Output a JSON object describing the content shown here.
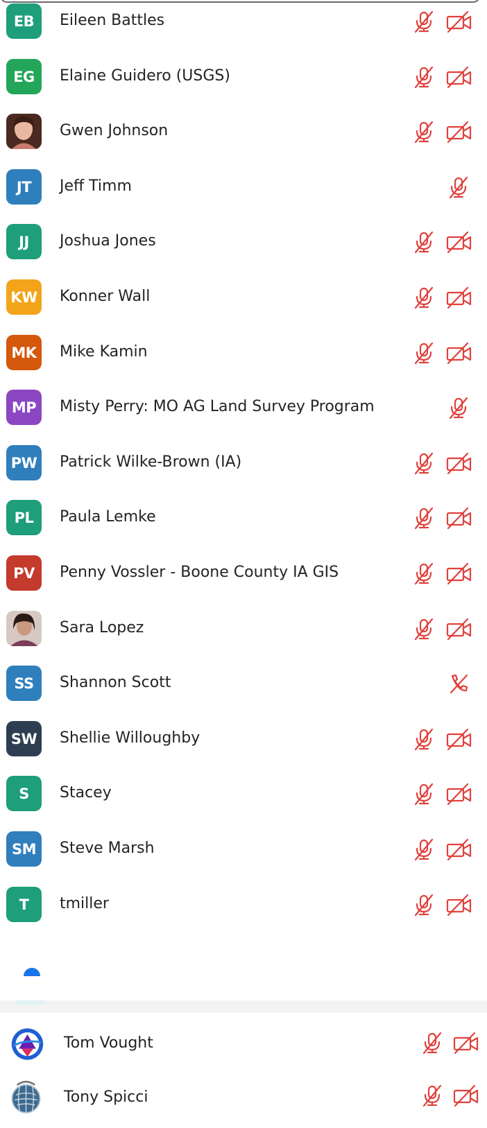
{
  "participants": [
    {
      "initials": "EB",
      "name": "Eileen Battles",
      "color": "#1e9e7a",
      "mic": "muted",
      "video": "off"
    },
    {
      "initials": "EG",
      "name": "Elaine Guidero (USGS)",
      "color": "#23a65a",
      "mic": "muted",
      "video": "off"
    },
    {
      "initials": "",
      "name": "Gwen Johnson",
      "color": "#a87e6a",
      "mic": "muted",
      "video": "off",
      "photo": true
    },
    {
      "initials": "JT",
      "name": "Jeff Timm",
      "color": "#2f7fbd",
      "mic": "muted",
      "video": "none"
    },
    {
      "initials": "JJ",
      "name": "Joshua Jones",
      "color": "#1e9e7a",
      "mic": "muted",
      "video": "off"
    },
    {
      "initials": "KW",
      "name": "Konner Wall",
      "color": "#f2a51a",
      "mic": "muted",
      "video": "off"
    },
    {
      "initials": "MK",
      "name": "Mike Kamin",
      "color": "#d4580c",
      "mic": "muted",
      "video": "off"
    },
    {
      "initials": "MP",
      "name": "Misty Perry: MO AG Land Survey Program",
      "color": "#8b47c2",
      "mic": "muted",
      "video": "none"
    },
    {
      "initials": "PW",
      "name": "Patrick Wilke-Brown (IA)",
      "color": "#2f7fbd",
      "mic": "muted",
      "video": "off"
    },
    {
      "initials": "PL",
      "name": "Paula Lemke",
      "color": "#1e9e7a",
      "mic": "muted",
      "video": "off"
    },
    {
      "initials": "PV",
      "name": "Penny Vossler - Boone County IA GIS",
      "color": "#c43a2c",
      "mic": "muted",
      "video": "off"
    },
    {
      "initials": "",
      "name": "Sara Lopez",
      "color": "#8a6a62",
      "mic": "muted",
      "video": "off",
      "photo": true
    },
    {
      "initials": "SS",
      "name": "Shannon Scott",
      "color": "#2f7fbd",
      "mic": "phone",
      "video": "none"
    },
    {
      "initials": "SW",
      "name": "Shellie Willoughby",
      "color": "#2e3e52",
      "mic": "muted",
      "video": "off"
    },
    {
      "initials": "S",
      "name": "Stacey",
      "color": "#1e9e7a",
      "mic": "muted",
      "video": "off"
    },
    {
      "initials": "SM",
      "name": "Steve Marsh",
      "color": "#2f7fbd",
      "mic": "muted",
      "video": "off"
    },
    {
      "initials": "T",
      "name": "tmiller",
      "color": "#1e9e7a",
      "mic": "muted",
      "video": "off"
    }
  ],
  "attendees": [
    {
      "name": "Tom Vought",
      "mic": "muted",
      "video": "off"
    },
    {
      "name": "Tony Spicci",
      "mic": "muted",
      "video": "off"
    }
  ],
  "icon_color": "#e0413c"
}
